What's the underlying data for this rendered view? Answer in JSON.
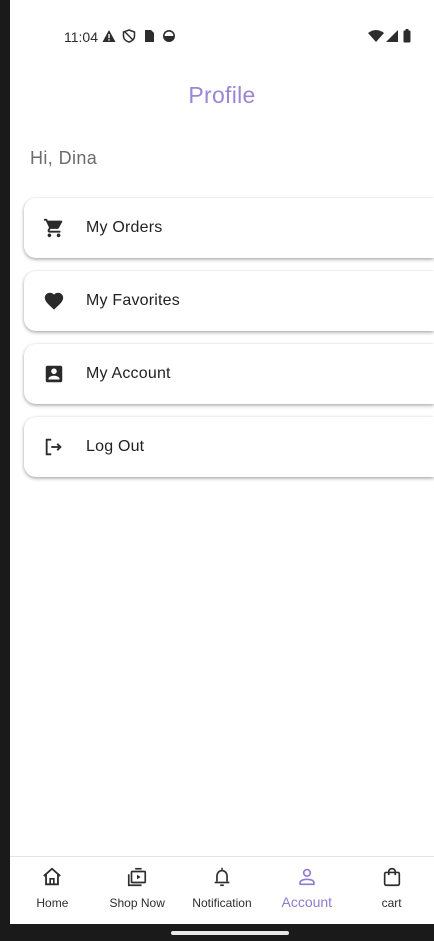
{
  "status_bar": {
    "time": "11:04",
    "left_icons": [
      "warning-icon",
      "shield-icon",
      "sim-card-icon",
      "data-saver-icon"
    ],
    "right_icons": [
      "wifi-icon",
      "cell-signal-icon",
      "battery-icon"
    ]
  },
  "header": {
    "title": "Profile"
  },
  "greeting": "Hi, Dina",
  "menu": {
    "items": [
      {
        "label": "My Orders",
        "icon": "cart-icon"
      },
      {
        "label": "My Favorites",
        "icon": "heart-icon"
      },
      {
        "label": "My Account",
        "icon": "account-box-icon"
      },
      {
        "label": "Log Out",
        "icon": "logout-icon"
      }
    ]
  },
  "bottom_nav": {
    "items": [
      {
        "label": "Home",
        "icon": "home-icon"
      },
      {
        "label": "Shop Now",
        "icon": "shop-play-icon"
      },
      {
        "label": "Notification",
        "icon": "bell-icon"
      },
      {
        "label": "Account",
        "icon": "person-icon",
        "active": true
      },
      {
        "label": "cart",
        "icon": "shopping-bag-icon"
      }
    ]
  },
  "colors": {
    "accent": "#9a86d4",
    "active_nav": "#8f7ad1",
    "text_primary": "#222222",
    "text_secondary": "#6b6b6b"
  }
}
